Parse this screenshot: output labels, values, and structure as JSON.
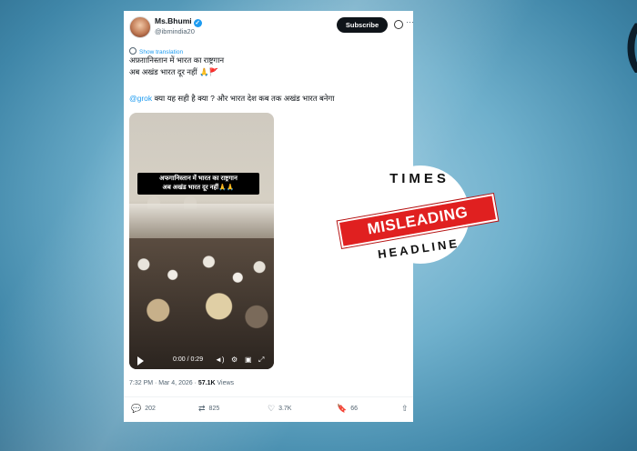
{
  "tweet": {
    "display_name": "Ms.Bhumi",
    "handle": "@ibmindia20",
    "subscribe_label": "Subscribe",
    "show_translation": "Show translation",
    "text_line1": "अफ़ग़ानिस्तान में भारत का राष्ट्रगान",
    "text_line2": "अब अखंड भारत दूर नहीं 🙏🚩",
    "mention": "@grok",
    "text_line3": " क्या यह सही है क्या ? और भारत देश कब तक अखंड भारत बनेगा",
    "video": {
      "caption_line1": "अफगानिस्तान में भारत का राष्ट्रगान",
      "caption_line2": "अब अखंड भारत दूर नहीं🙏🙏",
      "time": "0:00 / 0:29"
    },
    "timestamp": "7:32 PM · Mar 4, 2026 · ",
    "views_count": "57.1K",
    "views_label": " Views",
    "replies": "202",
    "reposts": "825",
    "likes": "3.7K",
    "bookmarks": "66"
  },
  "stamp": {
    "top": "TIMES",
    "middle": "MISLEADING",
    "bottom": "HEADLINE"
  },
  "colors": {
    "accent": "#1d9bf0",
    "stamp_red": "#e02020"
  }
}
